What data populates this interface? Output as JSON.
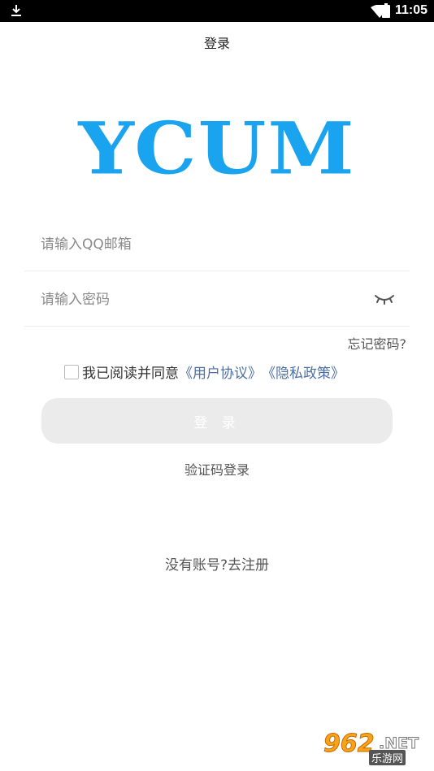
{
  "status_bar": {
    "time": "11:05",
    "icons": [
      "download-icon",
      "wifi-icon",
      "battery-icon"
    ]
  },
  "header": {
    "title": "登录"
  },
  "logo": {
    "text": "YCUM",
    "color": "#1aa3ef"
  },
  "form": {
    "email_placeholder": "请输入QQ邮箱",
    "password_placeholder": "请输入密码",
    "forgot_label": "忘记密码?",
    "agree_prefix": "我已阅读并同意",
    "user_agreement": "《用户协议》",
    "privacy_policy": "《隐私政策》",
    "agree_checked": false,
    "login_label": "登 录",
    "code_login_label": "验证码登录"
  },
  "register": {
    "prompt": "没有账号?",
    "link": "去注册"
  },
  "watermark": {
    "number": "962",
    "suffix": ".NET",
    "sub": "乐游网"
  },
  "colors": {
    "accent": "#1aa3ef",
    "link": "#4d6fa3",
    "button_disabled": "#ebebeb"
  }
}
